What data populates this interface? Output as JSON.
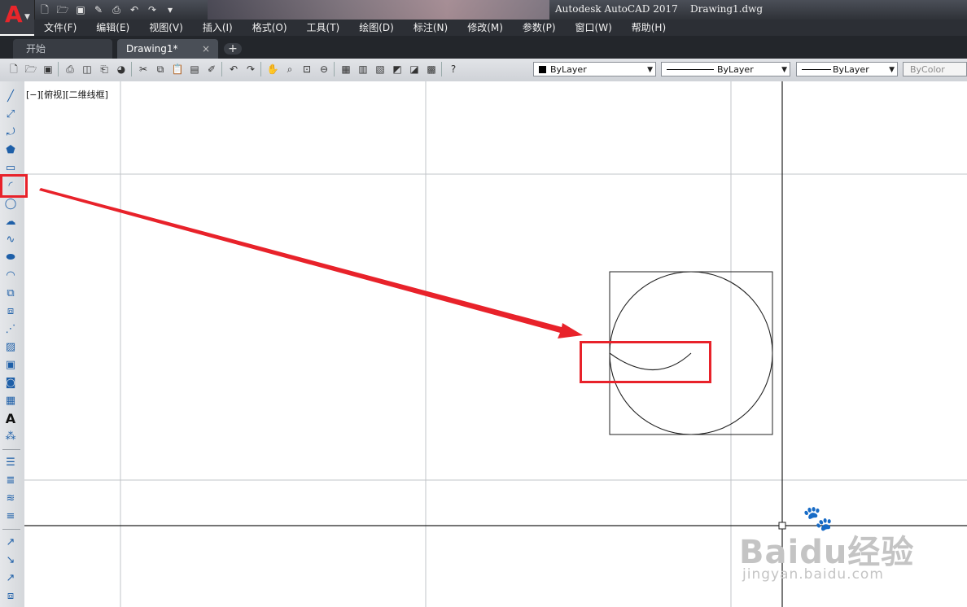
{
  "app": {
    "logo_letter": "A",
    "title": "Autodesk AutoCAD 2017    Drawing1.dwg",
    "accent_color": "#e8262b"
  },
  "quick_access": [
    "new-icon",
    "open-icon",
    "save-icon",
    "saveas-icon",
    "plot-icon",
    "undo-icon",
    "redo-icon",
    "customize-icon"
  ],
  "menu": [
    "文件(F)",
    "编辑(E)",
    "视图(V)",
    "插入(I)",
    "格式(O)",
    "工具(T)",
    "绘图(D)",
    "标注(N)",
    "修改(M)",
    "参数(P)",
    "窗口(W)",
    "帮助(H)"
  ],
  "tabs": [
    {
      "label": "开始",
      "active": false
    },
    {
      "label": "Drawing1*",
      "active": true,
      "close": "×"
    }
  ],
  "tab_add": "+",
  "properties": {
    "layer": "ByLayer",
    "linetype": "ByLayer",
    "lineweight": "ByLayer",
    "color": "ByColor"
  },
  "viewport_label": "[−][俯视][二维线框]",
  "left_tools": [
    "line-icon",
    "xline-icon",
    "polyline-icon",
    "polygon-icon",
    "rectangle-icon",
    "arc-icon",
    "circle-icon",
    "revcloud-icon",
    "spline-icon",
    "ellipse-icon",
    "ellipse-arc-icon",
    "insert-block-icon",
    "make-block-icon",
    "point-icon",
    "hatch-icon",
    "gradient-icon",
    "region-icon",
    "table-icon",
    "mtext-icon",
    "add-selected-icon"
  ],
  "annotation_color": "#e8222a",
  "watermark": {
    "brand": "Baidu经验",
    "site": "jingyan.baidu.com"
  }
}
